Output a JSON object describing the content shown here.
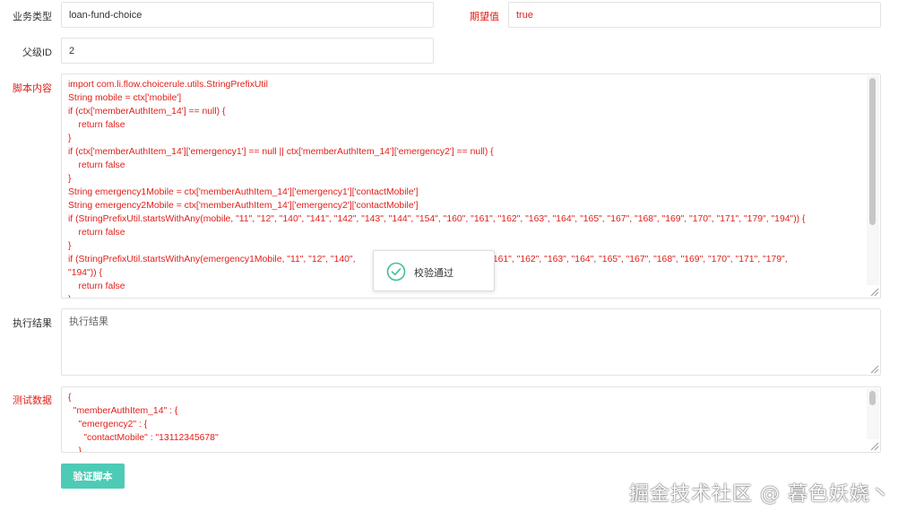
{
  "form": {
    "business_type_label": "业务类型",
    "business_type_value": "loan-fund-choice",
    "expected_label": "期望值",
    "expected_value": "true",
    "parent_id_label": "父级ID",
    "parent_id_value": "2",
    "script_label": "脚本内容",
    "script_lines": [
      "import com.li.flow.choicerule.utils.StringPrefixUtil",
      "String mobile = ctx['mobile']",
      "if (ctx['memberAuthItem_14'] == null) {",
      "    return false",
      "}",
      "if (ctx['memberAuthItem_14']['emergency1'] == null || ctx['memberAuthItem_14']['emergency2'] == null) {",
      "    return false",
      "}",
      "String emergency1Mobile = ctx['memberAuthItem_14']['emergency1']['contactMobile']",
      "String emergency2Mobile = ctx['memberAuthItem_14']['emergency2']['contactMobile']",
      "if (StringPrefixUtil.startsWithAny(mobile, \"11\", \"12\", \"140\", \"141\", \"142\", \"143\", \"144\", \"154\", \"160\", \"161\", \"162\", \"163\", \"164\", \"165\", \"167\", \"168\", \"169\", \"170\", \"171\", \"179\", \"194\")) {",
      "    return false",
      "}",
      "if (StringPrefixUtil.startsWithAny(emergency1Mobile, \"11\", \"12\", \"140\",                                  54\", \"160\", \"161\", \"162\", \"163\", \"164\", \"165\", \"167\", \"168\", \"169\", \"170\", \"171\", \"179\",",
      "\"194\")) {",
      "    return false",
      "}"
    ],
    "result_label": "执行结果",
    "result_placeholder": "执行结果",
    "test_data_label": "测试数据",
    "test_data_lines": [
      "{",
      "  \"memberAuthItem_14\" : {",
      "    \"emergency2\" : {",
      "      \"contactMobile\" : \"13112345678\"",
      "    },"
    ],
    "verify_button_label": "验证脚本"
  },
  "toast": {
    "message": "校验通过",
    "icon": "check-circle-icon",
    "color": "#3fbf95"
  },
  "watermark": "掘金技术社区 @ 暮色妖娆丶",
  "colors": {
    "accent_button": "#4ecbb6",
    "required_label": "#e0201a",
    "code_text": "#e0201a"
  }
}
